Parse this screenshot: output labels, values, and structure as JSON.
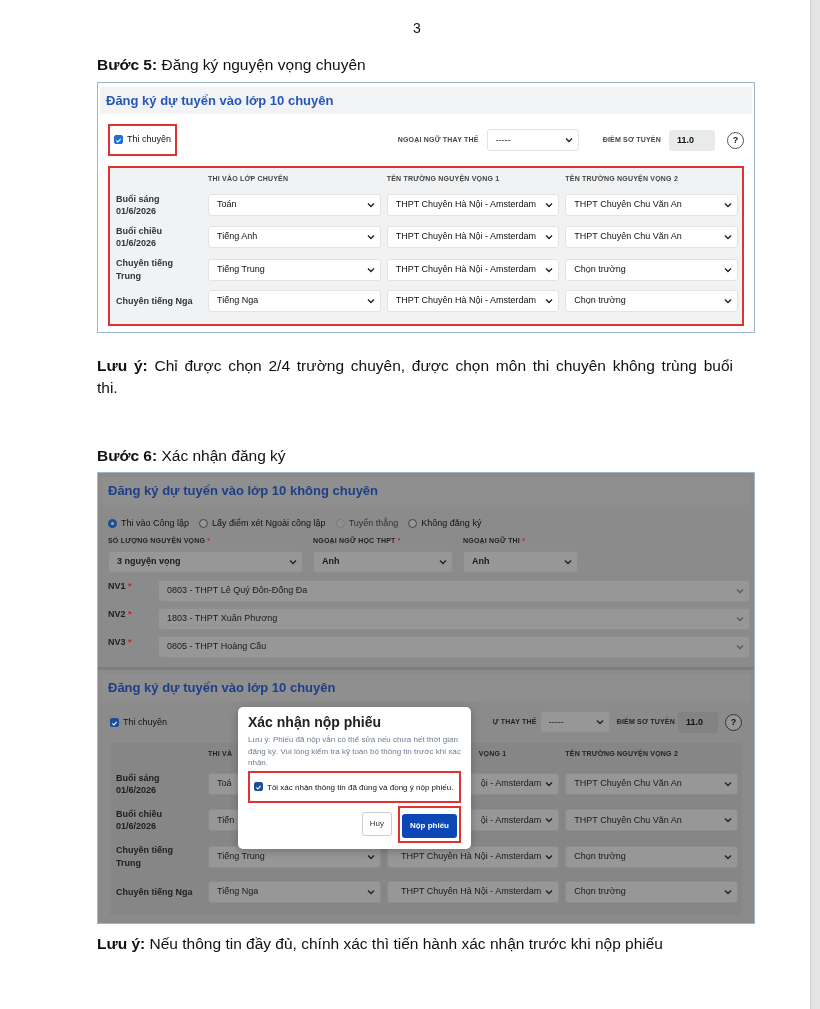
{
  "page_number": "3",
  "step_5": "**Bước 5:** Đăng ký nguyện vọng chuyên",
  "screenshot_1": {
    "title": "Đăng ký dự tuyển vào lớp 10 chuyên",
    "checkbox": {
      "label": "Thi chuyên",
      "checked": true,
      "highlighted": true
    },
    "substitute_language": {
      "label": "NGOẠI NGỮ THAY THẾ",
      "value": "-----"
    },
    "screening_score": {
      "label": "ĐIỂM SƠ TUYỂN",
      "value": "11.0"
    },
    "help_button": "?",
    "grid": {
      "highlighted": true,
      "columns": [
        "THI VÀO LỚP CHUYÊN",
        "TÊN TRƯỜNG NGUYỆN VỌNG 1",
        "TÊN TRƯỜNG NGUYỆN VỌNG 2"
      ],
      "rows": [
        {
          "label": "Buổi sáng\n01/6/2026",
          "cells": [
            "Toán",
            "THPT Chuyên Hà Nội - Amsterdam",
            "THPT Chuyên Chu Văn An"
          ]
        },
        {
          "label": "Buổi chiều\n01/6/2026",
          "cells": [
            "Tiếng Anh",
            "THPT Chuyên Hà Nội - Amsterdam",
            "THPT Chuyên Chu Văn An"
          ]
        },
        {
          "label": "Chuyên tiếng\nTrung",
          "cells": [
            "Tiếng Trung",
            "THPT Chuyên Hà Nội - Amsterdam",
            "Chọn trường"
          ]
        },
        {
          "label": "Chuyên tiếng Nga",
          "cells": [
            "Tiếng Nga",
            "THPT Chuyên Hà Nội - Amsterdam",
            "Chọn trường"
          ]
        }
      ]
    }
  },
  "note_1": "**Lưu ý:** Chỉ được chọn 2/4 trường chuyên, được chọn môn thi chuyên không trùng buổi thi.",
  "step_6": "**Bước 6:** Xác nhận đăng ký",
  "screenshot_2": {
    "regular_form": {
      "title": "Đăng ký dự tuyển vào lớp 10 không chuyên",
      "radios": [
        {
          "label": "Thi vào Công lập",
          "selected": true,
          "disabled": false
        },
        {
          "label": "Lấy điểm xét Ngoài công lập",
          "selected": false,
          "disabled": false
        },
        {
          "label": "Tuyển thẳng",
          "selected": false,
          "disabled": true
        },
        {
          "label": "Không đăng ký",
          "selected": false,
          "disabled": false
        }
      ],
      "fields": [
        {
          "label": "SỐ LƯỢNG NGUYỆN VỌNG",
          "mark": "*",
          "value": "3 nguyện vọng"
        },
        {
          "label": "NGOẠI NGỮ HỌC THPT",
          "mark": "*",
          "value": "Anh"
        },
        {
          "label": "NGOẠI NGỮ THI",
          "mark": "*",
          "value": "Anh"
        }
      ],
      "choices": [
        {
          "label": "NV1",
          "mark": "*",
          "value": "0803 - THPT Lê Quý Đôn-Đống Đa"
        },
        {
          "label": "NV2",
          "mark": "*",
          "value": "1803 - THPT Xuân Phương"
        },
        {
          "label": "NV3",
          "mark": "*",
          "value": "0805 - THPT Hoàng Cầu"
        }
      ]
    },
    "specialized_form": {
      "title": "Đăng ký dự tuyển vào lớp 10 chuyên",
      "checkbox": {
        "label": "Thi chuyên",
        "checked": true,
        "highlighted": false
      },
      "substitute_language": {
        "label": "Ự THAY THẾ",
        "value": "-----"
      },
      "screening_score": {
        "label": "ĐIỂM SƠ TUYỂN",
        "value": "11.0"
      },
      "help_button": "?",
      "grid": {
        "highlighted": false,
        "columns": [
          "THI VÀ",
          "VỌNG 1",
          "TÊN TRƯỜNG NGUYỆN VỌNG 2"
        ],
        "rows": [
          {
            "label": "Buổi sáng\n01/6/2026",
            "cells": [
              "Toá",
              "ội - Amsterdam",
              "THPT Chuyên Chu Văn An"
            ]
          },
          {
            "label": "Buổi chiều\n01/6/2026",
            "cells": [
              "Tiến",
              "ội - Amsterdam",
              "THPT Chuyên Chu Văn An"
            ]
          },
          {
            "label": "Chuyên tiếng\nTrung",
            "cells": [
              "Tiếng Trung",
              "THPT Chuyên Hà Nội - Amsterdam",
              "Chọn trường"
            ]
          },
          {
            "label": "Chuyên tiếng Nga",
            "cells": [
              "Tiếng Nga",
              "THPT Chuyên Hà Nội - Amsterdam",
              "Chọn trường"
            ]
          }
        ]
      }
    },
    "modal": {
      "title": "Xác nhận nộp phiếu",
      "text": "Lưu ý: Phiếu đã nộp vẫn có thể sửa nếu chưa hết thời gian đăng ký. Vui lòng kiểm tra kỹ toàn bộ thông tin trước khi xác nhận.",
      "checkbox": {
        "label": "Tôi xác nhận thông tin đã đúng và đồng ý nộp phiếu.",
        "checked": true,
        "highlighted": true
      },
      "buttons": [
        {
          "label": "Huỷ",
          "kind": "secondary",
          "highlighted": false
        },
        {
          "label": "Nộp phiếu",
          "kind": "primary",
          "highlighted": true
        }
      ]
    }
  },
  "note_2": "**Lưu ý:** Nếu thông tin đầy đủ, chính xác thì tiến hành xác nhận trước khi nộp phiếu"
}
